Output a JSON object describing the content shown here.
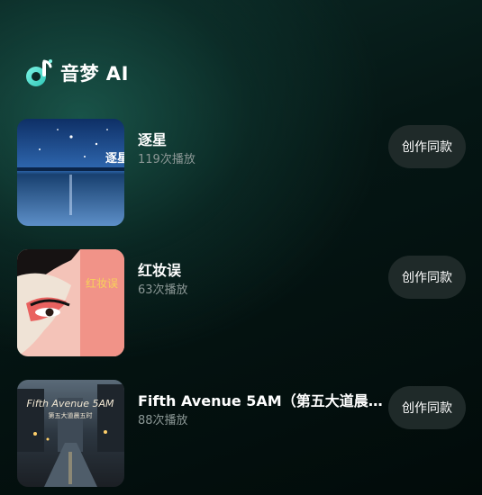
{
  "app": {
    "brand_name": "音梦 AI",
    "logo_icon": "music-note-logo-icon",
    "accent_color": "#2fe0c8"
  },
  "songs": [
    {
      "title": "逐星",
      "plays": "119次播放",
      "cover_text": "逐星",
      "action": "创作同款"
    },
    {
      "title": "红妆误",
      "plays": "63次播放",
      "cover_text": "红妆误",
      "action": "创作同款"
    },
    {
      "title": "Fifth Avenue 5AM（第五大道晨...",
      "plays": "88次播放",
      "cover_text": "Fifth Avenue 5AM",
      "cover_subtext": "第五大道晨五时",
      "action": "创作同款"
    }
  ]
}
